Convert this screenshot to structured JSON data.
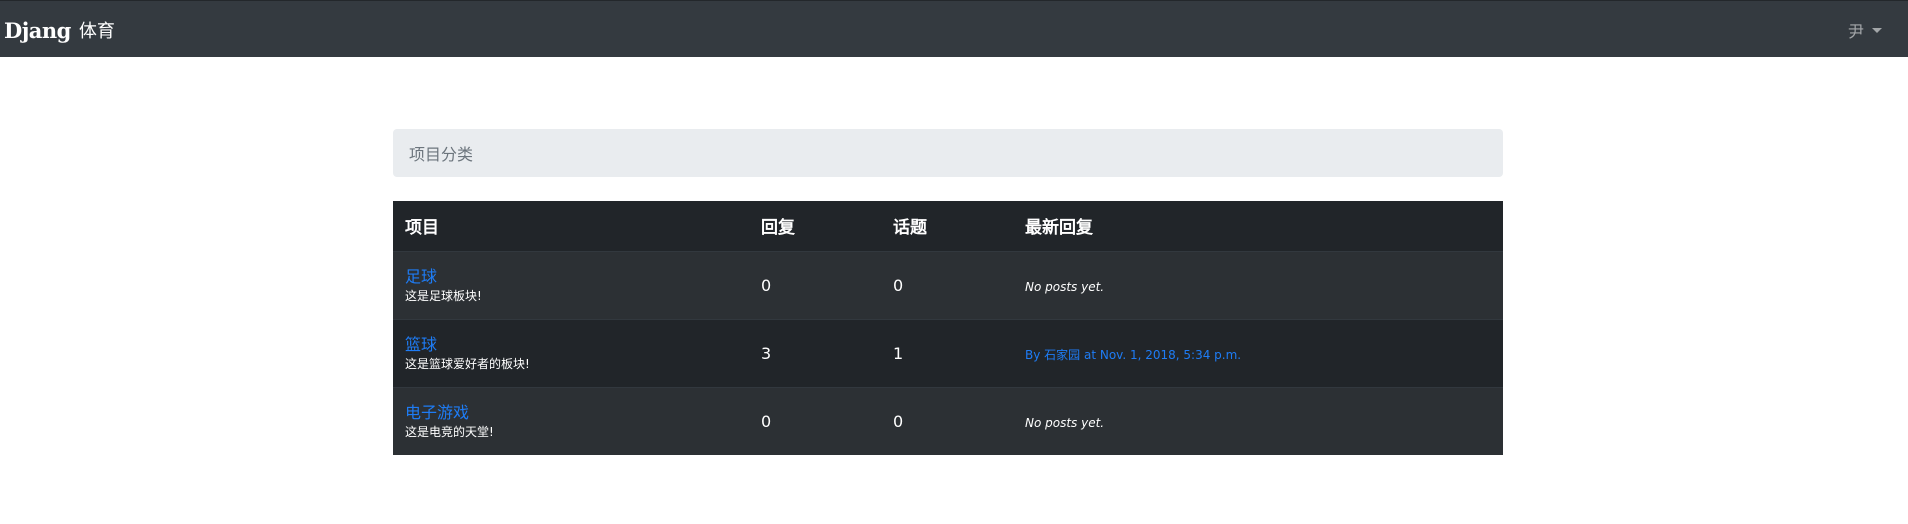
{
  "navbar": {
    "brand_logo": "Djang",
    "brand_text": "体育",
    "user_name": "尹"
  },
  "breadcrumb": {
    "active": "项目分类"
  },
  "table": {
    "headers": [
      "项目",
      "回复",
      "话题",
      "最新回复"
    ],
    "rows": [
      {
        "name": "足球",
        "description": "这是足球板块!",
        "posts": "0",
        "topics": "0",
        "last_post": "No posts yet.",
        "has_link": false
      },
      {
        "name": "篮球",
        "description": "这是篮球爱好者的板块!",
        "posts": "3",
        "topics": "1",
        "last_post": "By 石家园 at Nov. 1, 2018, 5:34 p.m.",
        "has_link": true
      },
      {
        "name": "电子游戏",
        "description": "这是电竞的天堂!",
        "posts": "0",
        "topics": "0",
        "last_post": "No posts yet.",
        "has_link": false
      }
    ]
  },
  "colors": {
    "navbar_bg": "#343a40",
    "table_dark": "#212529",
    "table_stripe": "#2c3034",
    "link": "#1e7cf5",
    "breadcrumb_bg": "#e9ecef"
  }
}
